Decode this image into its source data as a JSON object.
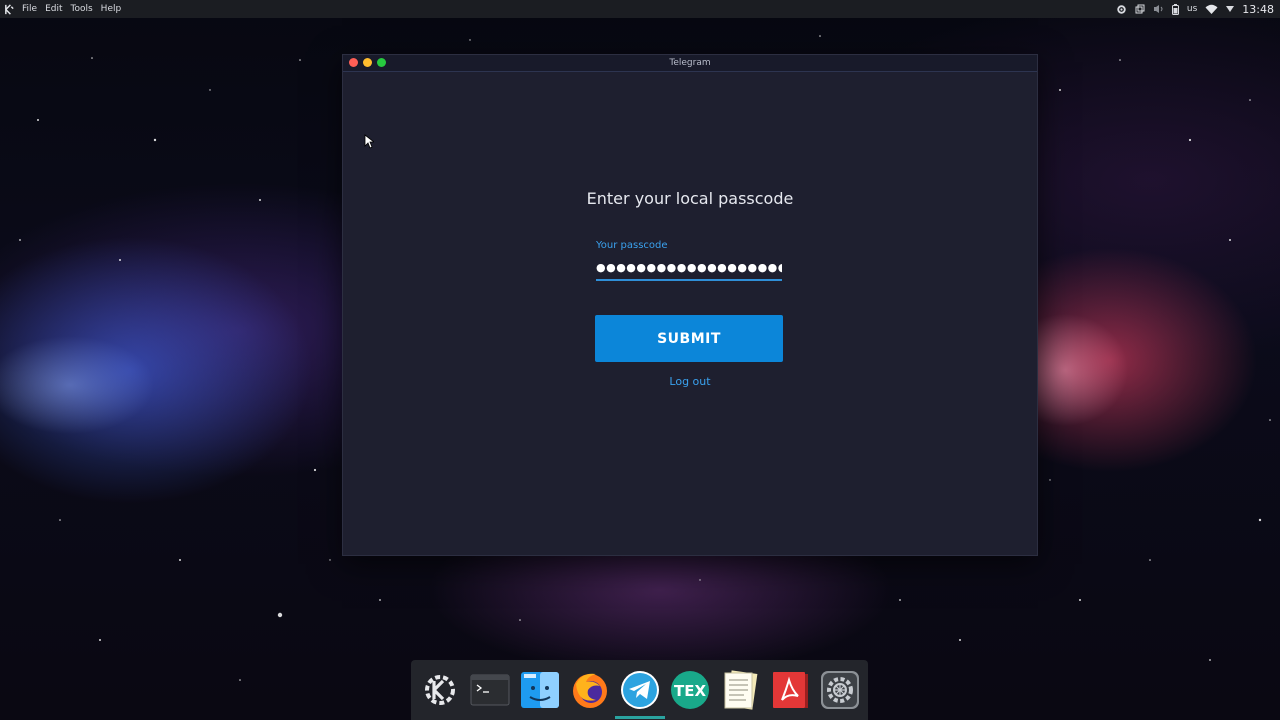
{
  "topbar": {
    "menu": [
      "File",
      "Edit",
      "Tools",
      "Help"
    ],
    "keyboard_layout": "us",
    "clock": "13:48",
    "icons": [
      "kde-logo-icon",
      "settings-icon",
      "window-icon",
      "volume-icon",
      "battery-icon",
      "wifi-icon",
      "dropdown-arrow-icon"
    ]
  },
  "window": {
    "title": "Telegram",
    "heading": "Enter your local passcode",
    "passcode_label": "Your passcode",
    "passcode_value": "●●●●●●●●●●●●●●●●●●●●",
    "submit_label": "SUBMIT",
    "logout_label": "Log out"
  },
  "dock": {
    "items": [
      "kde-icon",
      "terminal-icon",
      "finder-icon",
      "firefox-icon",
      "telegram-icon",
      "tex-icon",
      "notes-icon",
      "pdf-reader-icon",
      "system-settings-icon"
    ],
    "active": "telegram-icon",
    "tex_label": "TEX"
  },
  "colors": {
    "accent": "#0c86d9",
    "link": "#3aa1ee",
    "window_bg": "#1e1f2f",
    "topbar_bg": "#1b1d22"
  }
}
